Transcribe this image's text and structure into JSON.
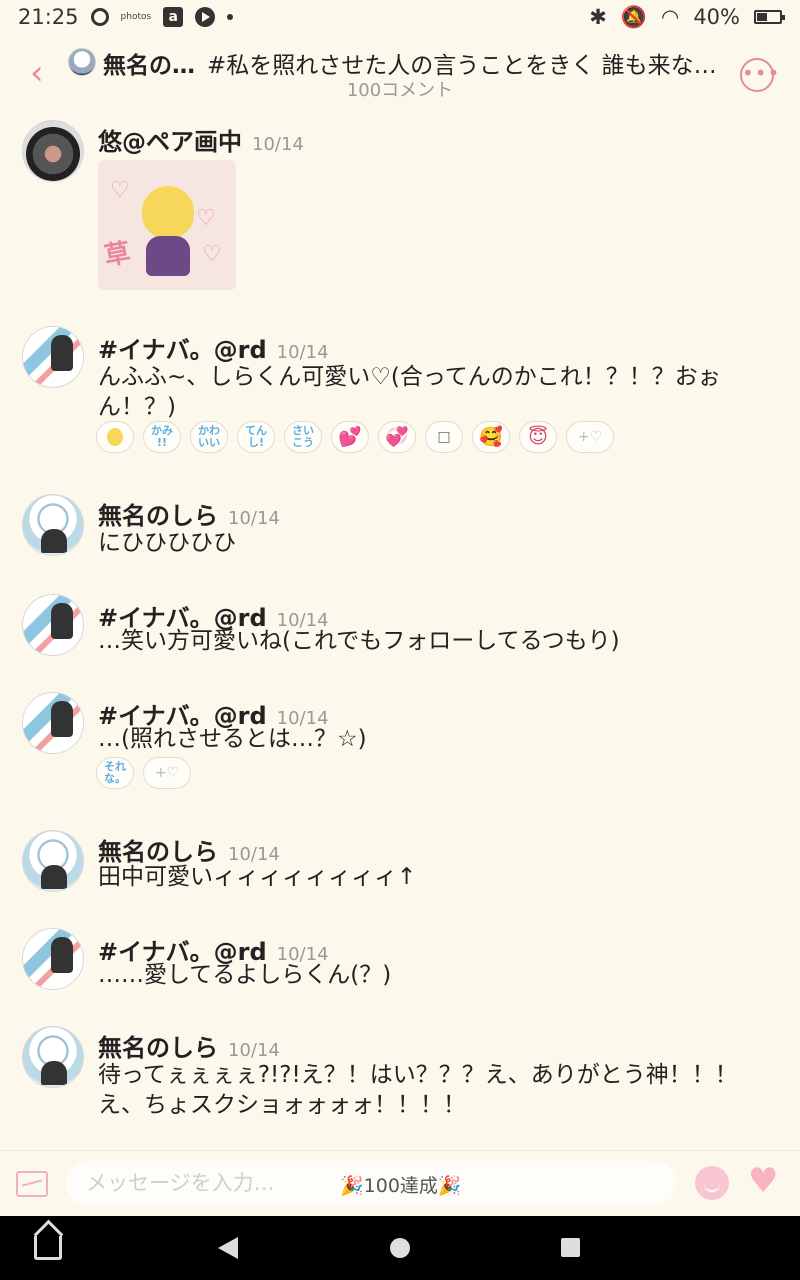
{
  "status": {
    "time": "21:25",
    "photos_label": "photos",
    "battery": "40%"
  },
  "header": {
    "group_name": "無名の…",
    "topic": "#私を照れさせた人の言うことをきく 誰も来な…",
    "comment_count": "100コメント"
  },
  "messages": [
    {
      "user": "悠@ペア画中",
      "date": "10/14",
      "text": "",
      "sticker": "草"
    },
    {
      "user": "#イナバ。@rd",
      "date": "10/14",
      "text": "んふふ~、しらくん可愛い♡(合ってんのかこれ！？！？おぉん！？)",
      "reactions": [
        "",
        "かみ\n!!",
        "かわ\nいい",
        "てん\nし!",
        "さい\nこう",
        "💕",
        "💞",
        "□",
        "🥰",
        "😇",
        "+♡"
      ]
    },
    {
      "user": "無名のしら",
      "date": "10/14",
      "text": "にひひひひひ"
    },
    {
      "user": "#イナバ。@rd",
      "date": "10/14",
      "text": "…笑い方可愛いね(これでもフォローしてるつもり)"
    },
    {
      "user": "#イナバ。@rd",
      "date": "10/14",
      "text": "…(照れさせるとは…？☆)",
      "reactions": [
        "それ\nな。",
        "+♡"
      ]
    },
    {
      "user": "無名のしら",
      "date": "10/14",
      "text": "田中可愛いィィィィィィィィ↑"
    },
    {
      "user": "#イナバ。@rd",
      "date": "10/14",
      "text": "……愛してるよしらくん(？)"
    },
    {
      "user": "無名のしら",
      "date": "10/14",
      "text": "待ってぇぇぇぇ?!?!え？！はい？？？え、ありがとう神！！！え、ちょスクショォォォォ！！！！"
    }
  ],
  "input": {
    "placeholder": "メッセージを入力…",
    "celebration": "🎉100達成🎉"
  },
  "colors": {
    "background": "#fdf8ec",
    "accent": "#e58aa0",
    "reaction_text": "#5aaee0"
  },
  "icons": [
    "back-chevron-icon",
    "more-options-icon",
    "image-icon",
    "smile-icon",
    "heart-icon",
    "home-icon",
    "nav-back-icon",
    "nav-home-circle-icon",
    "nav-recents-icon"
  ]
}
